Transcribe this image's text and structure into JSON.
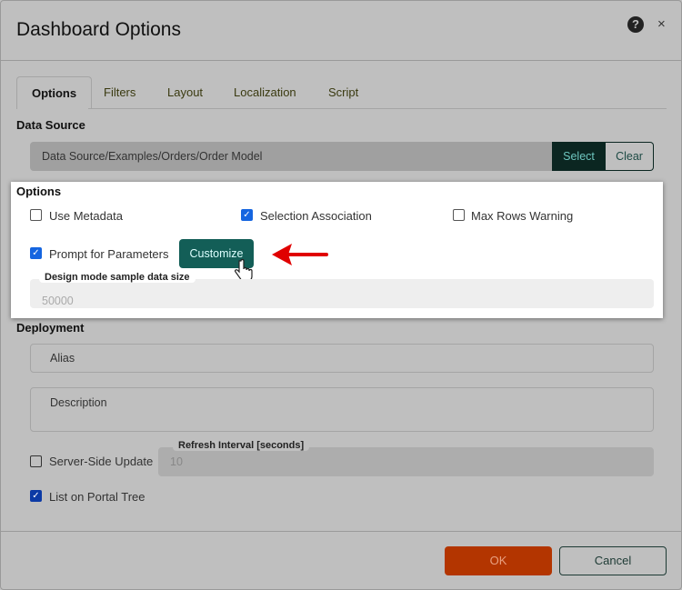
{
  "dialog": {
    "title": "Dashboard Options",
    "help_icon": "question-circle-icon",
    "close_icon": "close-icon",
    "close_glyph": "×",
    "help_glyph": "?"
  },
  "tabs": [
    {
      "label": "Options",
      "active": true
    },
    {
      "label": "Filters"
    },
    {
      "label": "Layout"
    },
    {
      "label": "Localization"
    },
    {
      "label": "Script"
    }
  ],
  "data_source": {
    "heading": "Data Source",
    "value": "Data Source/Examples/Orders/Order Model",
    "select_label": "Select",
    "clear_label": "Clear"
  },
  "options": {
    "heading": "Options",
    "use_metadata": {
      "label": "Use Metadata",
      "checked": false
    },
    "selection_association": {
      "label": "Selection Association",
      "checked": true
    },
    "max_rows_warning": {
      "label": "Max Rows Warning",
      "checked": false
    },
    "prompt_for_parameters": {
      "label": "Prompt for Parameters",
      "checked": true
    },
    "customize_label": "Customize",
    "sample_size": {
      "label": "Design mode sample data size",
      "value": "50000"
    }
  },
  "deployment": {
    "heading": "Deployment",
    "alias_placeholder": "Alias",
    "description_placeholder": "Description",
    "server_side_update": {
      "label": "Server-Side Update",
      "checked": false
    },
    "refresh_interval": {
      "label": "Refresh Interval [seconds]",
      "value": "10"
    },
    "list_on_portal_tree": {
      "label": "List on Portal Tree",
      "checked": true
    }
  },
  "footer": {
    "ok_label": "OK",
    "cancel_label": "Cancel"
  },
  "colors": {
    "accent": "#135e57",
    "ok": "#b33500",
    "arrow": "#e00000"
  }
}
